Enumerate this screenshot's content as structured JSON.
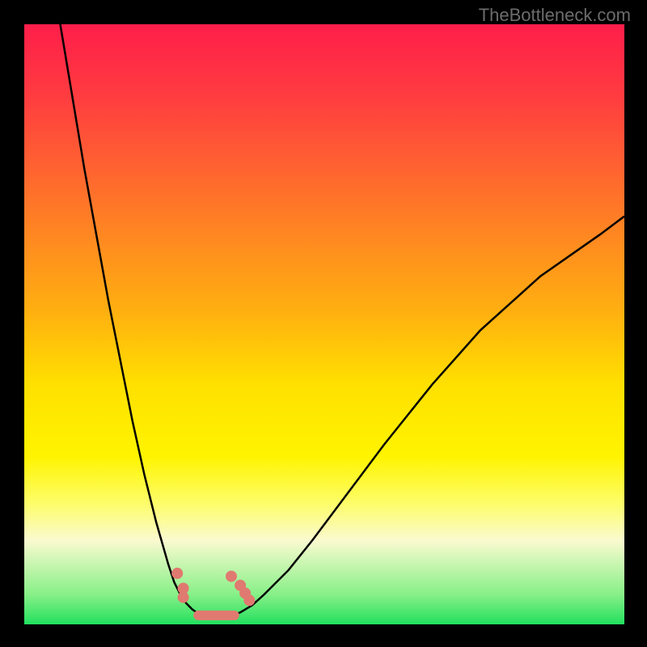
{
  "watermark": "TheBottleneck.com",
  "chart_data": {
    "type": "line",
    "title": "",
    "xlabel": "",
    "ylabel": "",
    "xlim": [
      0,
      100
    ],
    "ylim": [
      0,
      100
    ],
    "series": [
      {
        "name": "left-curve",
        "x": [
          6,
          10,
          14,
          18,
          20,
          22,
          24,
          25,
          26,
          27,
          28,
          29,
          30
        ],
        "values": [
          100,
          76,
          54,
          34,
          25,
          17,
          10,
          7,
          5,
          3.5,
          2.5,
          1.8,
          1.2
        ]
      },
      {
        "name": "right-curve",
        "x": [
          34,
          36,
          38,
          40,
          44,
          48,
          54,
          60,
          68,
          76,
          86,
          96,
          100
        ],
        "values": [
          1.2,
          2,
          3.2,
          5,
          9,
          14,
          22,
          30,
          40,
          49,
          58,
          65,
          68
        ]
      }
    ],
    "valley": {
      "name": "valley-segment",
      "x": [
        30,
        34
      ],
      "value": 1.0
    },
    "markers": [
      {
        "x": 25.5,
        "y": 8.5
      },
      {
        "x": 26.5,
        "y": 6.0
      },
      {
        "x": 26.5,
        "y": 4.5
      },
      {
        "x": 34.5,
        "y": 8.0
      },
      {
        "x": 36.0,
        "y": 6.5
      },
      {
        "x": 36.8,
        "y": 5.2
      },
      {
        "x": 37.5,
        "y": 4.0
      }
    ],
    "markerBarStart": {
      "x": 29,
      "y": 1.5
    },
    "markerBarEnd": {
      "x": 35,
      "y": 1.5
    },
    "colors": {
      "curve": "#000000",
      "markers": "#e07a70",
      "gradientTop": "#ff1e4a",
      "gradientBottom": "#22e05e"
    }
  }
}
